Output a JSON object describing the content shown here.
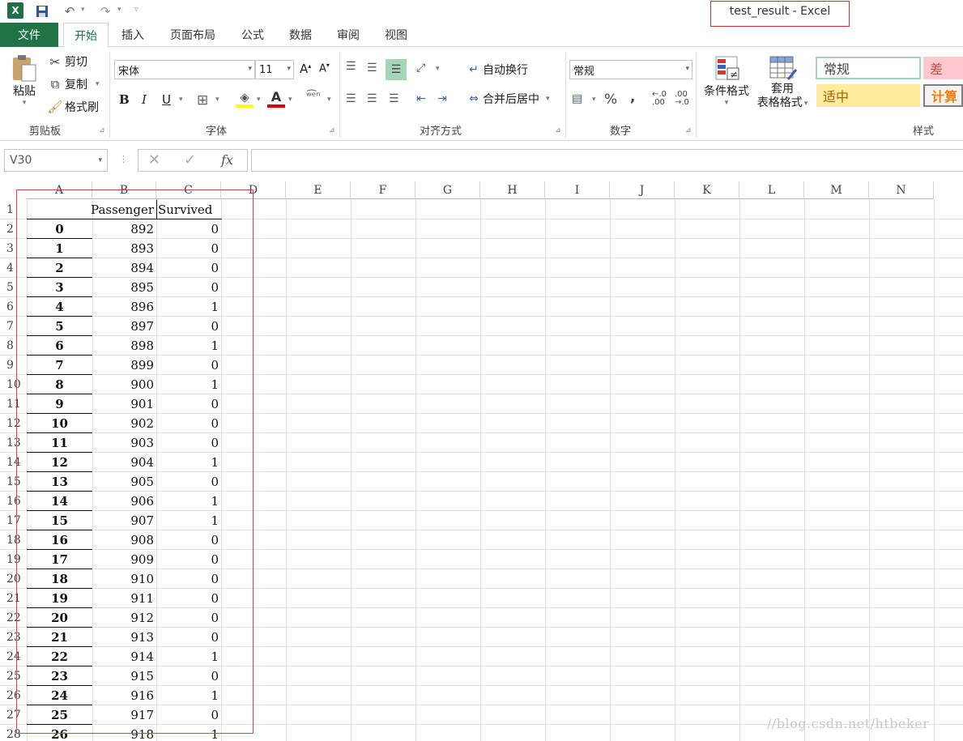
{
  "window": {
    "title": "test_result - Excel"
  },
  "quick_access": {
    "logo": "X"
  },
  "tabs": [
    {
      "label": "文件"
    },
    {
      "label": "开始"
    },
    {
      "label": "插入"
    },
    {
      "label": "页面布局"
    },
    {
      "label": "公式"
    },
    {
      "label": "数据"
    },
    {
      "label": "审阅"
    },
    {
      "label": "视图"
    }
  ],
  "ribbon": {
    "clipboard": {
      "paste": "粘贴",
      "cut": "剪切",
      "copy": "复制",
      "format_painter": "格式刷",
      "label": "剪贴板"
    },
    "font": {
      "name": "宋体",
      "size": "11",
      "bold": "B",
      "italic": "I",
      "underline": "U",
      "label": "字体"
    },
    "alignment": {
      "wrap": "自动换行",
      "merge": "合并后居中",
      "label": "对齐方式"
    },
    "number": {
      "format": "常规",
      "percent": "%",
      "comma": ",",
      "label": "数字"
    },
    "styles": {
      "conditional": "条件格式",
      "table_line1": "套用",
      "table_line2": "表格格式",
      "normal": "常规",
      "bad": "差",
      "neutral": "适中",
      "calc": "计算",
      "label": "样式"
    }
  },
  "formula_bar": {
    "name_box": "V30",
    "fx": "fx",
    "value": ""
  },
  "grid": {
    "columns": [
      "A",
      "B",
      "C",
      "D",
      "E",
      "F",
      "G",
      "H",
      "I",
      "J",
      "K",
      "L",
      "M",
      "N"
    ],
    "headers": {
      "B": "Passenger",
      "C": "Survived"
    },
    "rows": [
      {
        "a": "0",
        "b": "892",
        "c": "0"
      },
      {
        "a": "1",
        "b": "893",
        "c": "0"
      },
      {
        "a": "2",
        "b": "894",
        "c": "0"
      },
      {
        "a": "3",
        "b": "895",
        "c": "0"
      },
      {
        "a": "4",
        "b": "896",
        "c": "1"
      },
      {
        "a": "5",
        "b": "897",
        "c": "0"
      },
      {
        "a": "6",
        "b": "898",
        "c": "1"
      },
      {
        "a": "7",
        "b": "899",
        "c": "0"
      },
      {
        "a": "8",
        "b": "900",
        "c": "1"
      },
      {
        "a": "9",
        "b": "901",
        "c": "0"
      },
      {
        "a": "10",
        "b": "902",
        "c": "0"
      },
      {
        "a": "11",
        "b": "903",
        "c": "0"
      },
      {
        "a": "12",
        "b": "904",
        "c": "1"
      },
      {
        "a": "13",
        "b": "905",
        "c": "0"
      },
      {
        "a": "14",
        "b": "906",
        "c": "1"
      },
      {
        "a": "15",
        "b": "907",
        "c": "1"
      },
      {
        "a": "16",
        "b": "908",
        "c": "0"
      },
      {
        "a": "17",
        "b": "909",
        "c": "0"
      },
      {
        "a": "18",
        "b": "910",
        "c": "0"
      },
      {
        "a": "19",
        "b": "911",
        "c": "0"
      },
      {
        "a": "20",
        "b": "912",
        "c": "0"
      },
      {
        "a": "21",
        "b": "913",
        "c": "0"
      },
      {
        "a": "22",
        "b": "914",
        "c": "1"
      },
      {
        "a": "23",
        "b": "915",
        "c": "0"
      },
      {
        "a": "24",
        "b": "916",
        "c": "1"
      },
      {
        "a": "25",
        "b": "917",
        "c": "0"
      },
      {
        "a": "26",
        "b": "918",
        "c": "1"
      }
    ]
  },
  "watermark": "//blog.csdn.net/htbeker"
}
